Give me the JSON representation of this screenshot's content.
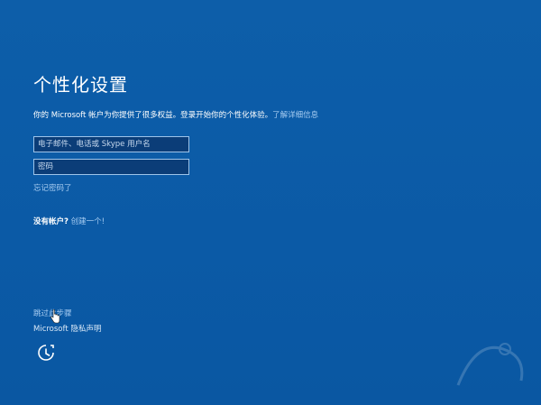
{
  "page": {
    "title": "个性化设置",
    "description_prefix": "你的 Microsoft 帐户为你提供了很多权益。登录开始你的个性化体验。",
    "learn_more_link": "了解详细信息"
  },
  "form": {
    "email_placeholder": "电子邮件、电话或 Skype 用户名",
    "password_placeholder": "密码",
    "forgot_password_link": "忘记密码了"
  },
  "signup": {
    "question": "没有帐户?",
    "create_link": "创建一个!"
  },
  "footer": {
    "skip_link": "跳过此步骤",
    "privacy_link": "Microsoft 隐私声明"
  },
  "icons": {
    "ease_of_access": "ease-of-access-icon",
    "cursor": "hand-cursor-icon"
  },
  "colors": {
    "background": "#0b5aa6",
    "link": "#a8cdf2",
    "input_background": "#0b3d78"
  }
}
